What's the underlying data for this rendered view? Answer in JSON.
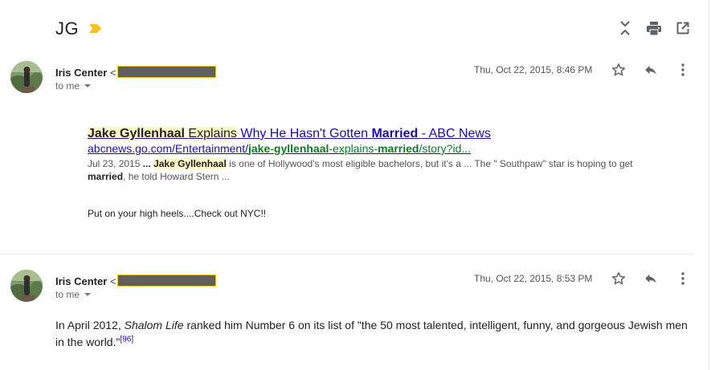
{
  "thread": {
    "subject": "JG",
    "label_color": "#f6c026",
    "toolbar_icons": [
      "collapse-all-icon",
      "print-icon",
      "open-in-new-window-icon"
    ]
  },
  "messages": [
    {
      "sender_name": "Iris Center",
      "sender_open": "<",
      "recipient": "to me",
      "date": "Thu, Oct 22, 2015, 8:46 PM",
      "search_result": {
        "title": {
          "t1": "Jake Gyllenhaal",
          "t2": " ",
          "t3": "Explains",
          "t4": " Why He Hasn't Gotten ",
          "t5": "Married",
          "t6": " - ABC News"
        },
        "url": {
          "u1": "abcnews.go.com/Entertainment/",
          "u2": "jake",
          "u3": "-",
          "u4": "gyllenhaal",
          "u5": "-explains-",
          "u6": "married",
          "u7": "/story?id..."
        },
        "snippet": {
          "s1": "Jul 23, 2015 ",
          "s2": "...",
          "s3": " ",
          "s4": "Jake Gyllenhaal",
          "s5": " is one of Hollywood's most eligible bachelors, but it's a ... The \" Southpaw\" star is hoping to get ",
          "s6": "married",
          "s7": ", he told Howard Stern ..."
        }
      },
      "body": "Put on your high heels....Check out NYC!!"
    },
    {
      "sender_name": "Iris Center",
      "sender_open": "<",
      "recipient": "to me",
      "date": "Thu, Oct 22, 2015, 8:53 PM",
      "body": {
        "p1": "In April 2012, ",
        "p2": "Shalom Life",
        "p3": " ranked him Number 6 on its list of \"the 50 most talented, intelligent, funny, and gorgeous Jewish men in the world.\"",
        "ref": "[96]"
      }
    }
  ]
}
